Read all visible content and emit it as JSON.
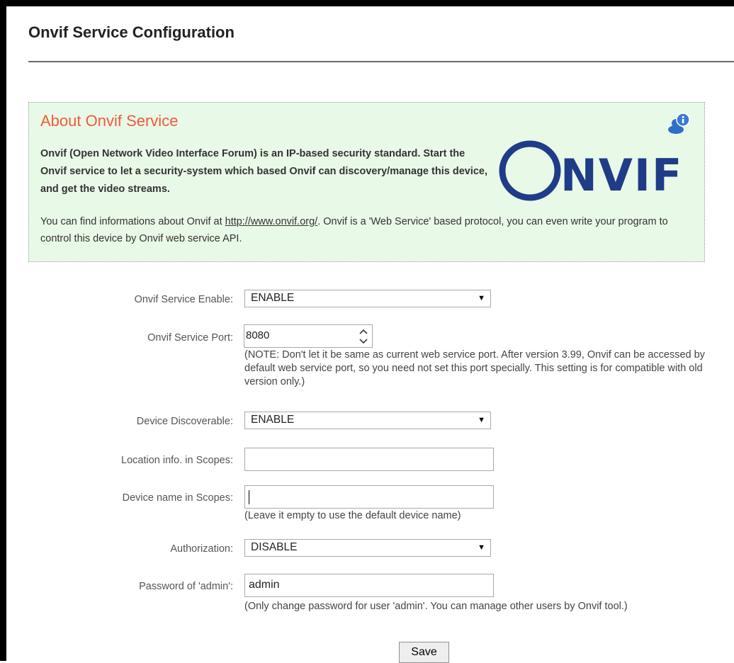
{
  "page": {
    "title": "Onvif Service Configuration"
  },
  "about": {
    "heading": "About Onvif Service",
    "info_icon": "info-icon",
    "bold_text": "Onvif (Open Network Video Interface Forum) is an IP-based security standard. Start the Onvif service to let a security-system which based Onvif can discovery/manage this device, and get the video streams.",
    "para_before_link": "You can find informations about Onvif at ",
    "link_text": "http://www.onvif.org/",
    "para_after_link": ". Onvif is a 'Web Service' based protocol, you can even write your program to control this device by Onvif web service API.",
    "logo_text": "ONVIF",
    "logo_color": "#1f3c88"
  },
  "form": {
    "service_enable": {
      "label": "Onvif Service Enable:",
      "value": "ENABLE"
    },
    "service_port": {
      "label": "Onvif Service Port:",
      "value": "8080",
      "note": "(NOTE: Don't let it be same as current web service port. After version 3.99, Onvif can be accessed by default web service port, so you need not set this port specially. This setting is for compatible with old version only.)"
    },
    "discoverable": {
      "label": "Device Discoverable:",
      "value": "ENABLE"
    },
    "location": {
      "label": "Location info. in Scopes:",
      "value": ""
    },
    "device_name": {
      "label": "Device name in Scopes:",
      "value": "",
      "note": "(Leave it empty to use the default device name)"
    },
    "authorization": {
      "label": "Authorization:",
      "value": "DISABLE"
    },
    "password": {
      "label": "Password of 'admin':",
      "value": "admin",
      "note": "(Only change password for user 'admin'. You can manage other users by Onvif tool.)"
    },
    "save_label": "Save"
  },
  "colors": {
    "heading_accent": "#f05a3c",
    "about_background": "#e9f9e7",
    "info_icon_blue": "#3a7bd5"
  }
}
